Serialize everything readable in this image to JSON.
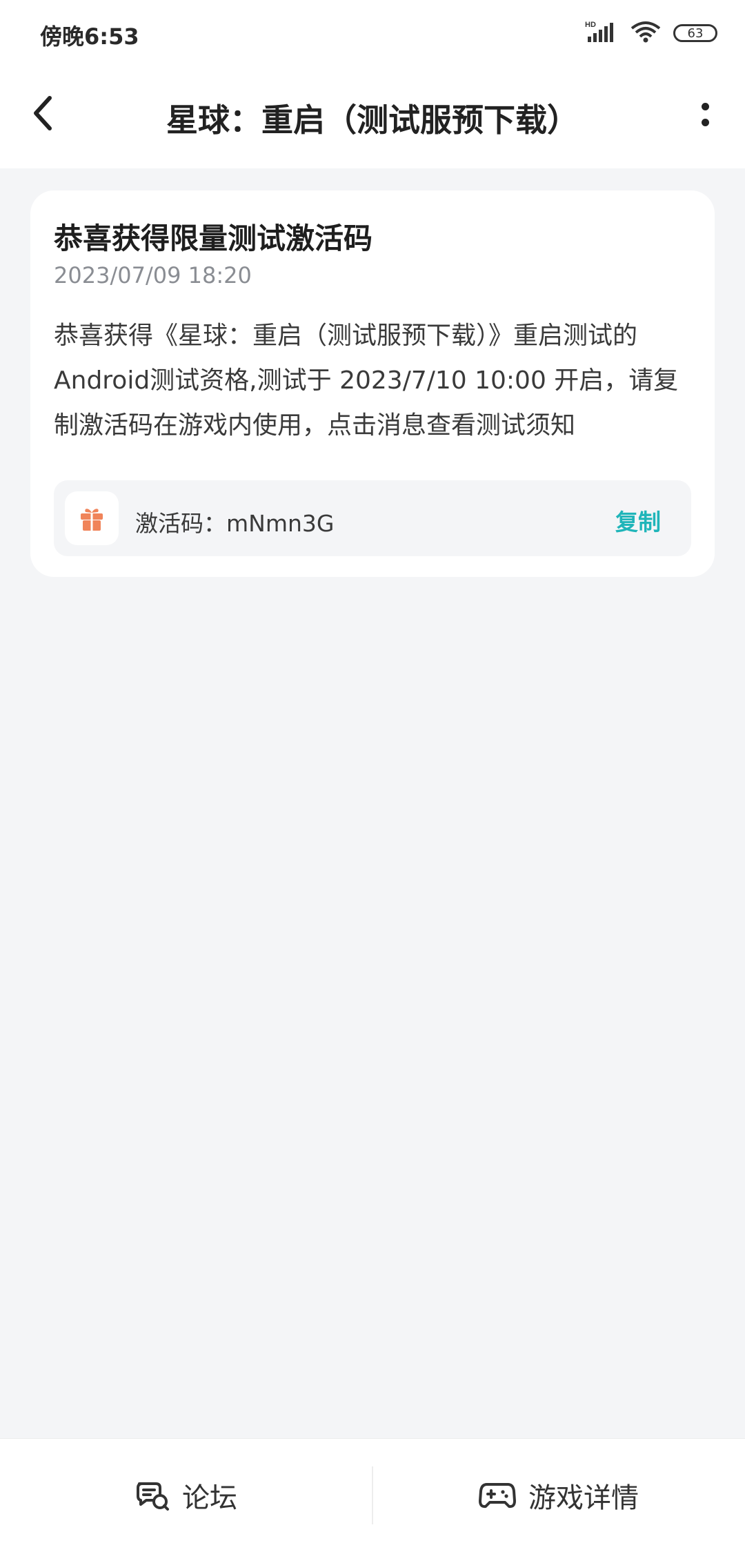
{
  "status_bar": {
    "time": "傍晚6:53",
    "battery": "63",
    "icons": [
      "hd-signal-icon",
      "wifi-icon",
      "battery-icon"
    ]
  },
  "nav": {
    "title": "星球：重启（测试服预下载）",
    "back_icon": "chevron-left-icon",
    "more_icon": "more-vertical-icon"
  },
  "card": {
    "title": "恭喜获得限量测试激活码",
    "date": "2023/07/09 18:20",
    "body": "恭喜获得《星球：重启（测试服预下载）》重启测试的Android测试资格,测试于 2023/7/10 10:00 开启，请复制激活码在游戏内使用，点击消息查看测试须知",
    "code_label": "激活码：mNmn3G",
    "copy_label": "复制",
    "gift_icon": "gift-icon"
  },
  "bottom": {
    "forum_label": "论坛",
    "game_details_label": "游戏详情",
    "forum_icon": "chat-bubbles-icon",
    "game_icon": "gamepad-icon"
  },
  "colors": {
    "accent": "#1fb5b9",
    "gift": "#f0845a",
    "background": "#f4f5f7"
  }
}
